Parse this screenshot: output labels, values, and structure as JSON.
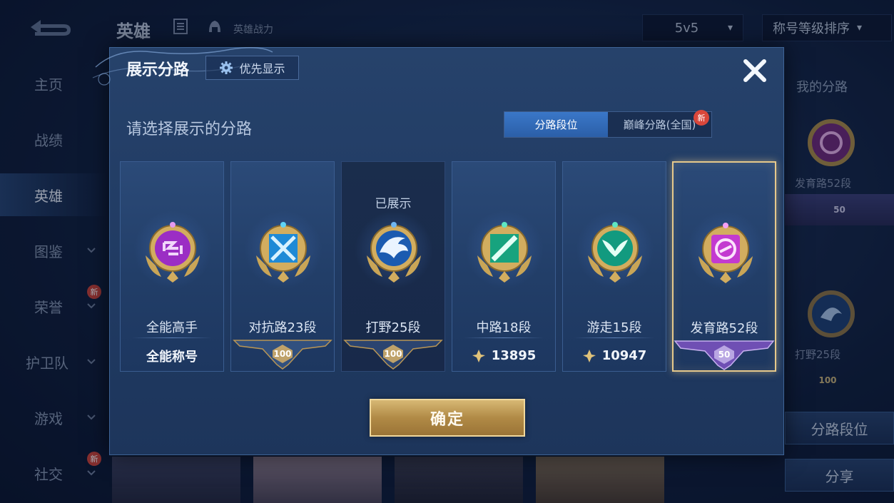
{
  "background": {
    "topbar": {
      "title": "英雄",
      "subtitle": "英雄战力",
      "mode_select": "5v5",
      "sort_select": "称号等级排序"
    },
    "sidebar": [
      {
        "label": "主页",
        "has_chevron": false,
        "is_new": false
      },
      {
        "label": "战绩",
        "has_chevron": false,
        "is_new": false
      },
      {
        "label": "英雄",
        "has_chevron": false,
        "is_new": false,
        "active": true
      },
      {
        "label": "图鉴",
        "has_chevron": true,
        "is_new": false
      },
      {
        "label": "荣誉",
        "has_chevron": true,
        "is_new": true
      },
      {
        "label": "护卫队",
        "has_chevron": true,
        "is_new": false
      },
      {
        "label": "游戏",
        "has_chevron": true,
        "is_new": false
      },
      {
        "label": "社交",
        "has_chevron": true,
        "is_new": true
      }
    ],
    "new_badge": "新",
    "right_panel": {
      "title": "我的分路",
      "primary_label": "发育路52段",
      "primary_tier": "50",
      "secondary_label": "打野25段",
      "secondary_tier": "100",
      "seg_button": "分路段位",
      "share_button": "分享"
    }
  },
  "modal": {
    "title": "展示分路",
    "priority_button": "优先显示",
    "prompt": "请选择展示的分路",
    "tabs": [
      {
        "label": "分路段位",
        "active": true,
        "is_new": false
      },
      {
        "label": "巅峰分路(全国)",
        "active": false,
        "is_new": true
      }
    ],
    "new_badge": "新",
    "shown_label": "已展示",
    "cards": [
      {
        "name": "全能高手",
        "footer_type": "text",
        "footer": "全能称号",
        "emblem": "allround",
        "gem": "#b23ad6",
        "state": "normal"
      },
      {
        "name": "对抗路23段",
        "footer_type": "tier",
        "footer": "100",
        "emblem": "clash",
        "gem": "#2fa3e6",
        "state": "normal"
      },
      {
        "name": "打野25段",
        "footer_type": "tier",
        "footer": "100",
        "emblem": "jungle",
        "gem": "#2a6fc4",
        "state": "shown"
      },
      {
        "name": "中路18段",
        "footer_type": "score",
        "footer": "13895",
        "emblem": "mid",
        "gem": "#1fb58a",
        "state": "normal"
      },
      {
        "name": "游走15段",
        "footer_type": "score",
        "footer": "10947",
        "emblem": "roam",
        "gem": "#16a88a",
        "state": "normal"
      },
      {
        "name": "发育路52段",
        "footer_type": "tier_purple",
        "footer": "50",
        "emblem": "farm",
        "gem": "#d43ecf",
        "state": "selected"
      }
    ],
    "confirm_button": "确定"
  },
  "colors": {
    "accent_gold": "#e6c98b",
    "tab_active": "#3a77c8",
    "badge_red": "#d9473b"
  }
}
